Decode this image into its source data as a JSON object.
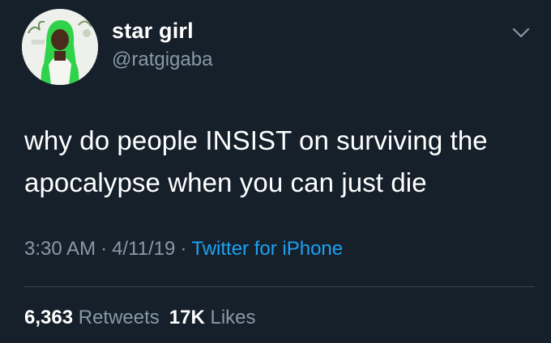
{
  "user": {
    "name": "star girl",
    "handle": "@ratgigaba",
    "avatar_icon": "profile-photo"
  },
  "tweet": {
    "text": "why do people INSIST on surviving the apocalypse when you can just die",
    "time": "3:30 AM",
    "date": "4/11/19",
    "separator": "·",
    "source": "Twitter for iPhone"
  },
  "stats": {
    "retweets_count": "6,363",
    "retweets_label": "Retweets",
    "likes_count": "17K",
    "likes_label": "Likes"
  },
  "colors": {
    "background": "#15202b",
    "secondary_text": "#8899a6",
    "link": "#1da1f2",
    "divider": "#38444d"
  },
  "menu_icon": "chevron-down-icon"
}
